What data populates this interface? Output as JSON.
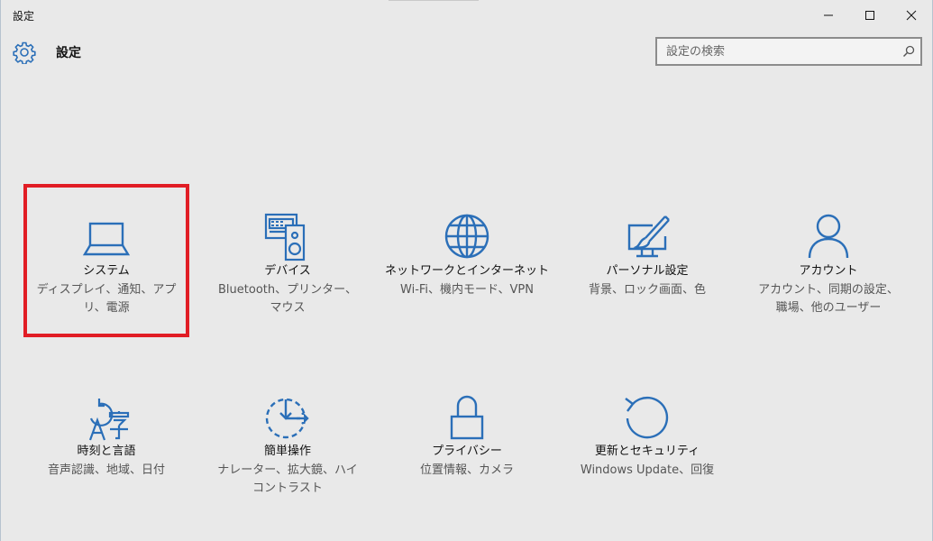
{
  "window": {
    "title": "設定"
  },
  "header": {
    "title": "設定",
    "icon": "gear-icon"
  },
  "search": {
    "placeholder": "設定の検索",
    "value": ""
  },
  "categories": [
    {
      "id": "system",
      "title": "システム",
      "desc": "ディスプレイ、通知、アプリ、電源",
      "icon": "laptop-icon",
      "selected": true
    },
    {
      "id": "devices",
      "title": "デバイス",
      "desc": "Bluetooth、プリンター、マウス",
      "icon": "devices-icon",
      "selected": false
    },
    {
      "id": "network",
      "title": "ネットワークとインターネット",
      "desc": "Wi-Fi、機内モード、VPN",
      "icon": "globe-icon",
      "selected": false
    },
    {
      "id": "personalization",
      "title": "パーソナル設定",
      "desc": "背景、ロック画面、色",
      "icon": "personalization-icon",
      "selected": false
    },
    {
      "id": "accounts",
      "title": "アカウント",
      "desc": "アカウント、同期の設定、職場、他のユーザー",
      "icon": "person-icon",
      "selected": false
    },
    {
      "id": "time-language",
      "title": "時刻と言語",
      "desc": "音声認識、地域、日付",
      "icon": "time-language-icon",
      "selected": false
    },
    {
      "id": "ease-of-access",
      "title": "簡単操作",
      "desc": "ナレーター、拡大鏡、ハイコントラスト",
      "icon": "ease-of-access-icon",
      "selected": false
    },
    {
      "id": "privacy",
      "title": "プライバシー",
      "desc": "位置情報、カメラ",
      "icon": "lock-icon",
      "selected": false
    },
    {
      "id": "update-security",
      "title": "更新とセキュリティ",
      "desc": "Windows Update、回復",
      "icon": "refresh-icon",
      "selected": false
    }
  ],
  "colors": {
    "accent": "#2b6fb8",
    "selection": "#e11d25",
    "background": "#e9e9e9"
  }
}
